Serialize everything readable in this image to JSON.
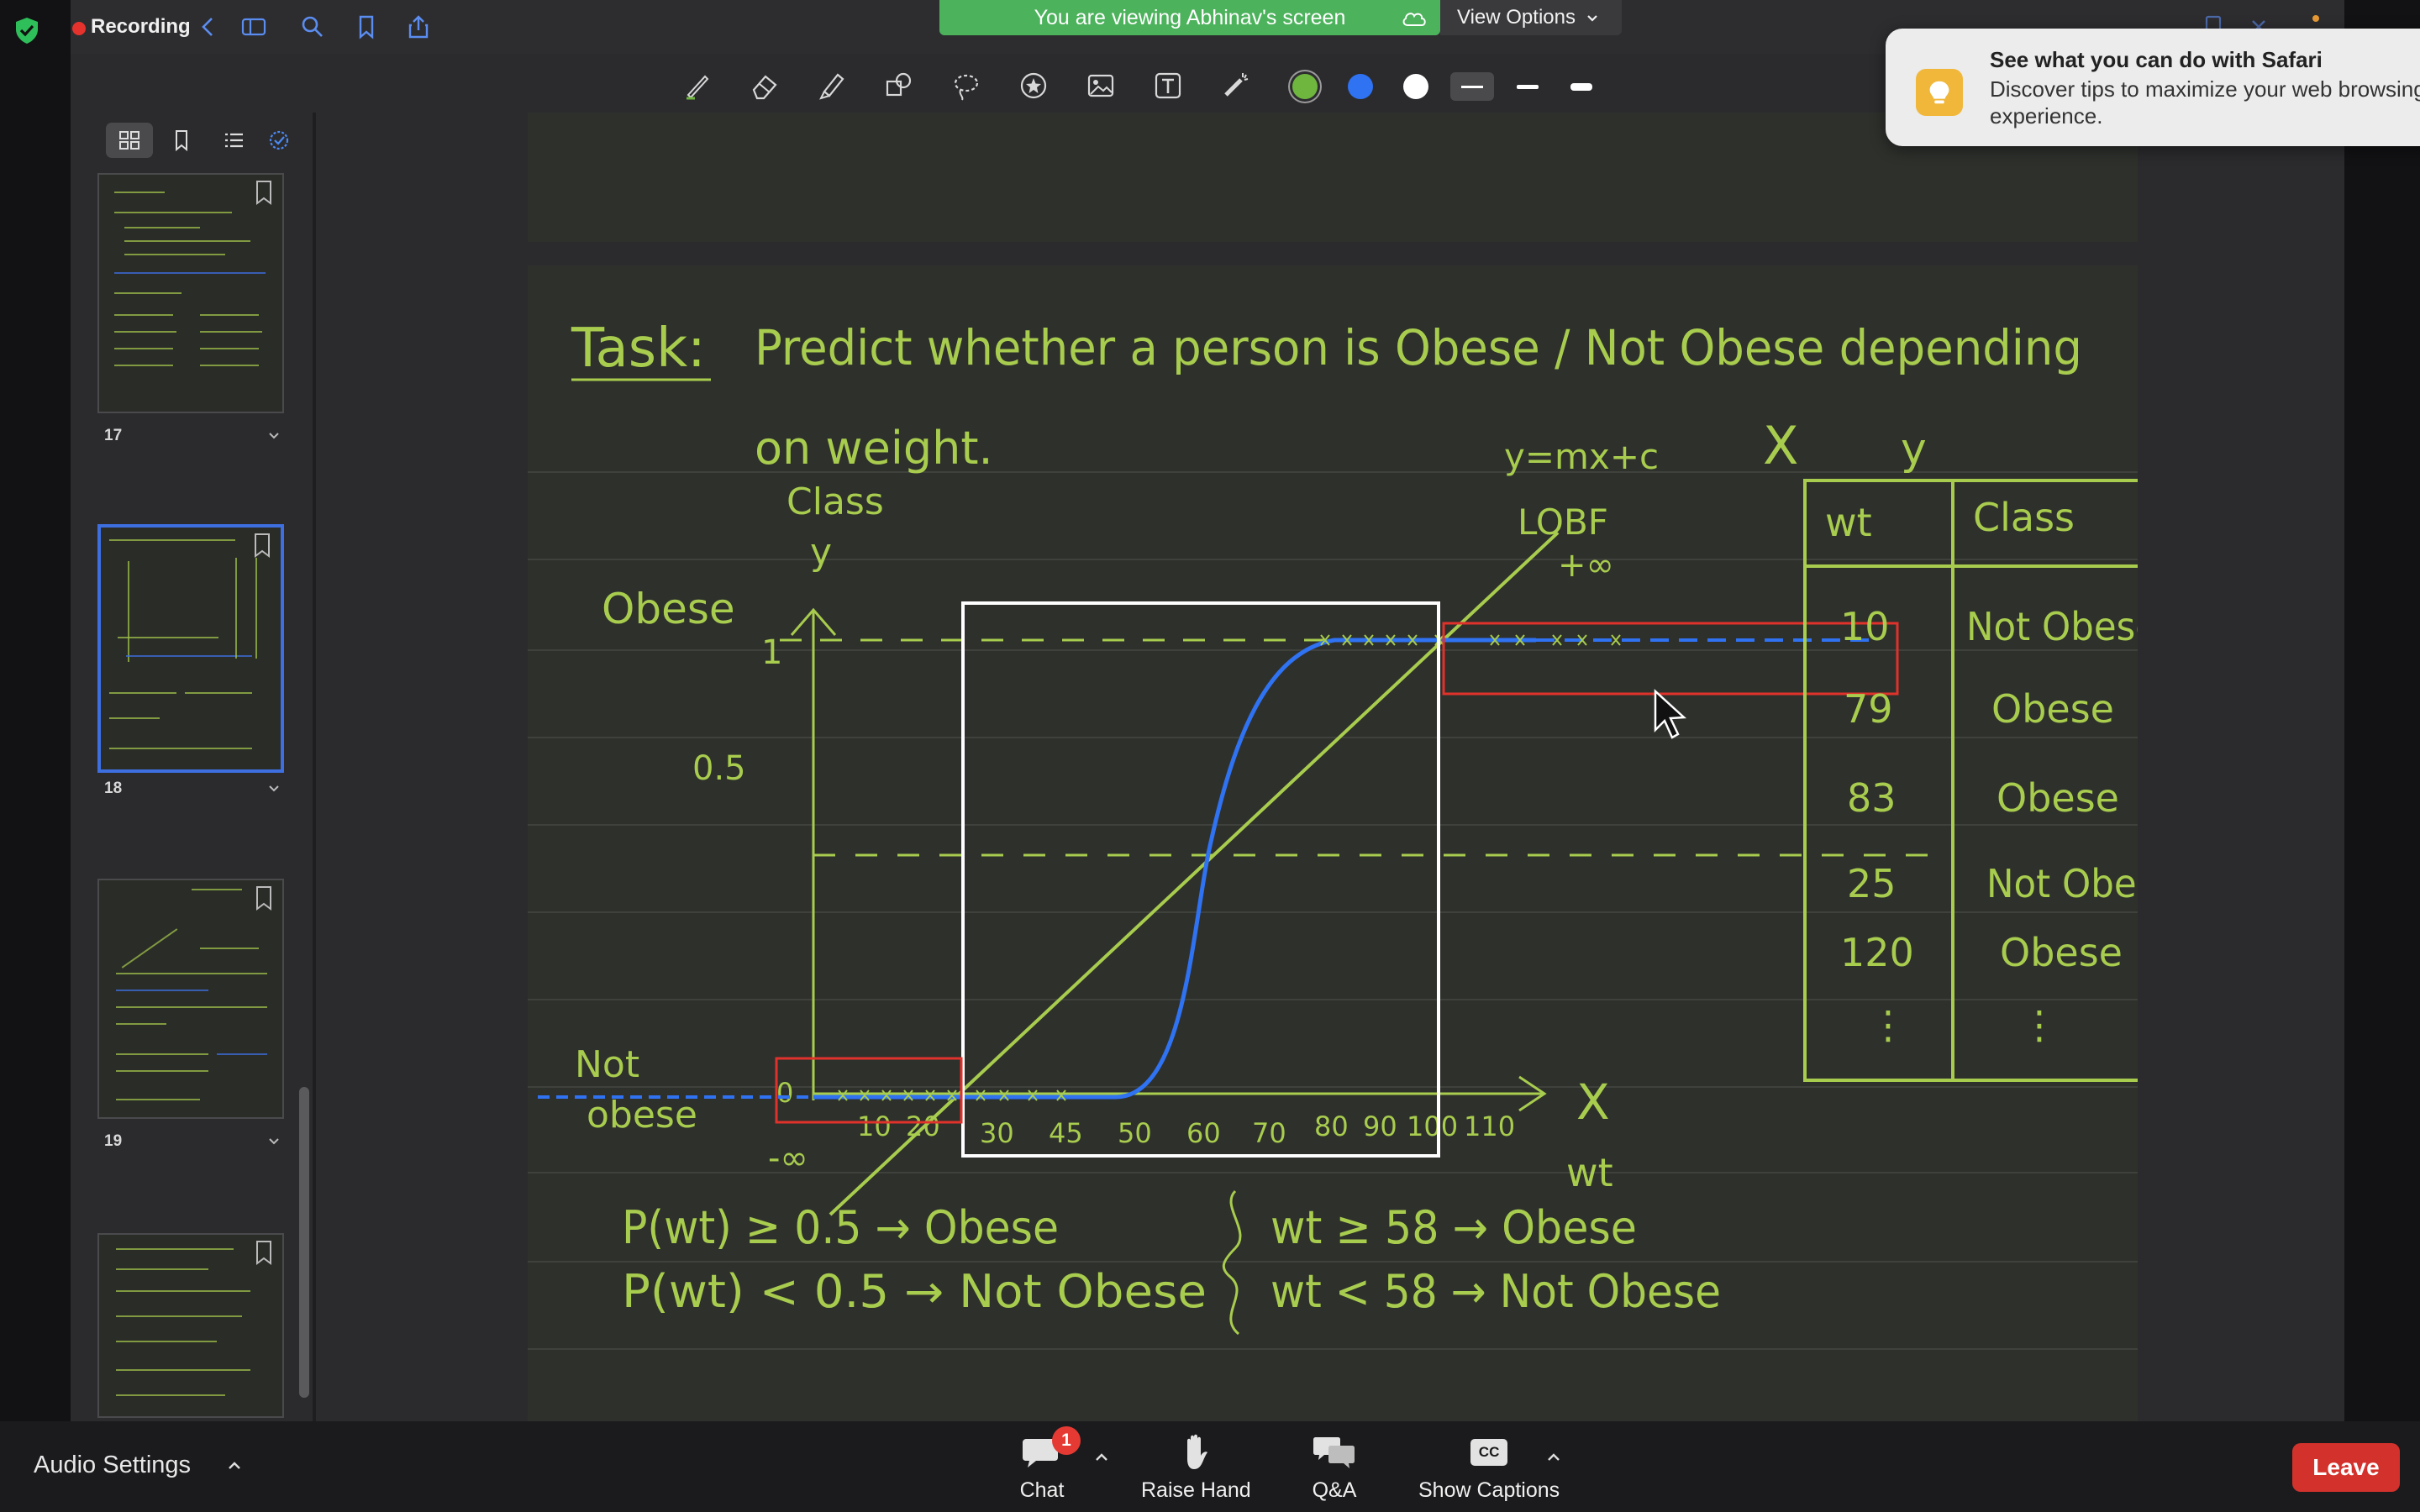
{
  "recording": {
    "label": "Recording"
  },
  "share_banner": {
    "text": "You are viewing Abhinav's screen"
  },
  "view_options": {
    "label": "View Options"
  },
  "notification": {
    "title": "See what you can do with Safari",
    "body": "Discover tips to maximize your web browsing experience."
  },
  "thumbnails": [
    {
      "number": "17"
    },
    {
      "number": "18",
      "selected": true
    },
    {
      "number": "19"
    }
  ],
  "annotation_colors": [
    "#6fb63f",
    "#2f72f2",
    "#ffffff"
  ],
  "page": {
    "task_label": "Task:",
    "task_text_1": "Predict whether a person is Obese / Not Obese depending",
    "task_text_2": "on weight.",
    "equation": "y=mx+c",
    "lobf": "LOBF",
    "plus_inf": "+∞",
    "minus_inf": "-∞",
    "axis_y_title_1": "Class",
    "axis_y_title_2": "y",
    "label_obese": "Obese",
    "label_not_1": "Not",
    "label_not_2": "obese",
    "tick_one": "1",
    "tick_half": "0.5",
    "axis_x_letter": "X",
    "axis_x_name": "wt",
    "x_ticks": [
      "0",
      "10",
      "20",
      "30",
      "45",
      "50",
      "60",
      "70",
      "80",
      "90",
      "100",
      "110"
    ],
    "table": {
      "col_x_head": "X",
      "col_y_head": "y",
      "headers": [
        "wt",
        "Class"
      ],
      "rows": [
        [
          "10",
          "Not Obese"
        ],
        [
          "79",
          "Obese"
        ],
        [
          "83",
          "Obese"
        ],
        [
          "25",
          "Not Obese"
        ],
        [
          "120",
          "Obese"
        ],
        [
          "⋮",
          "⋮"
        ]
      ]
    },
    "rule_1a": "P(wt) ≥ 0.5 → Obese",
    "rule_1b": "P(wt) < 0.5 → Not Obese",
    "rule_2a": "wt ≥ 58 → Obese",
    "rule_2b": "wt < 58 → Not Obese"
  },
  "bottom": {
    "audio_settings": "Audio Settings",
    "chat": "Chat",
    "chat_badge": "1",
    "raise_hand": "Raise Hand",
    "qa": "Q&A",
    "show_captions": "Show Captions",
    "captions_icon": "CC",
    "leave": "Leave"
  }
}
